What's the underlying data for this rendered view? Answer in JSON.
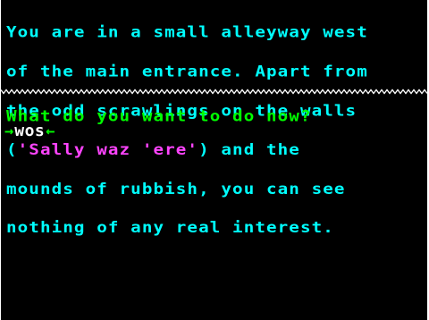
{
  "description": {
    "lines": [
      "You are in a small alleyway west",
      "of the main entrance. Apart from",
      "the odd scrawlings on the walls",
      "mounds of rubbish, you can see",
      "nothing of any real interest."
    ],
    "line4_open": "(",
    "line4_graffiti": "'Sally waz 'ere'",
    "line4_close": ") and the"
  },
  "prompt": {
    "question": "What do you want to do now?",
    "input_value": "wos",
    "left_arrow": "→",
    "right_arrow": "←"
  },
  "colors": {
    "background": "#000000",
    "description_text": "#00ffff",
    "graffiti_text": "#ff44ff",
    "prompt_text": "#00ff00",
    "input_text": "#ffffff",
    "divider": "#ffffff"
  }
}
